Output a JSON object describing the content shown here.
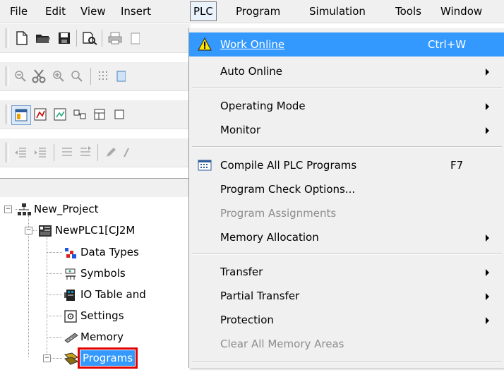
{
  "menubar": {
    "items": [
      {
        "label": "File"
      },
      {
        "label": "Edit"
      },
      {
        "label": "View"
      },
      {
        "label": "Insert"
      },
      {
        "label": "PLC"
      },
      {
        "label": "Program"
      },
      {
        "label": "Simulation"
      },
      {
        "label": "Tools"
      },
      {
        "label": "Window"
      }
    ]
  },
  "plc_menu": {
    "items": [
      {
        "label": "Work Online",
        "shortcut": "Ctrl+W",
        "highlighted": true,
        "icon": "warning-icon"
      },
      {
        "label": "Auto Online",
        "submenu": true
      },
      {
        "label": "Operating Mode",
        "submenu": true
      },
      {
        "label": "Monitor",
        "submenu": true
      },
      {
        "label": "Compile All PLC Programs",
        "shortcut": "F7",
        "icon": "compile-icon"
      },
      {
        "label": "Program Check Options..."
      },
      {
        "label": "Program Assignments",
        "disabled": true
      },
      {
        "label": "Memory Allocation",
        "submenu": true
      },
      {
        "label": "Transfer",
        "submenu": true
      },
      {
        "label": "Partial Transfer",
        "submenu": true
      },
      {
        "label": "Protection",
        "submenu": true
      },
      {
        "label": "Clear All Memory Areas",
        "disabled": true
      }
    ]
  },
  "project_tree": {
    "items": [
      {
        "label": "New_Project",
        "icon": "network-icon"
      },
      {
        "label": "NewPLC1[CJ2M",
        "icon": "plc-icon"
      },
      {
        "label": "Data Types",
        "icon": "data-types-icon"
      },
      {
        "label": "Symbols",
        "icon": "symbols-icon"
      },
      {
        "label": "IO Table and",
        "icon": "io-table-icon"
      },
      {
        "label": "Settings",
        "icon": "settings-icon"
      },
      {
        "label": "Memory",
        "icon": "memory-icon"
      },
      {
        "label": "Programs",
        "icon": "programs-icon",
        "selected": true
      }
    ]
  },
  "colors": {
    "highlight": "#3399ff",
    "selection_outline": "#e00000",
    "disabled_text": "#8d8d8d"
  }
}
